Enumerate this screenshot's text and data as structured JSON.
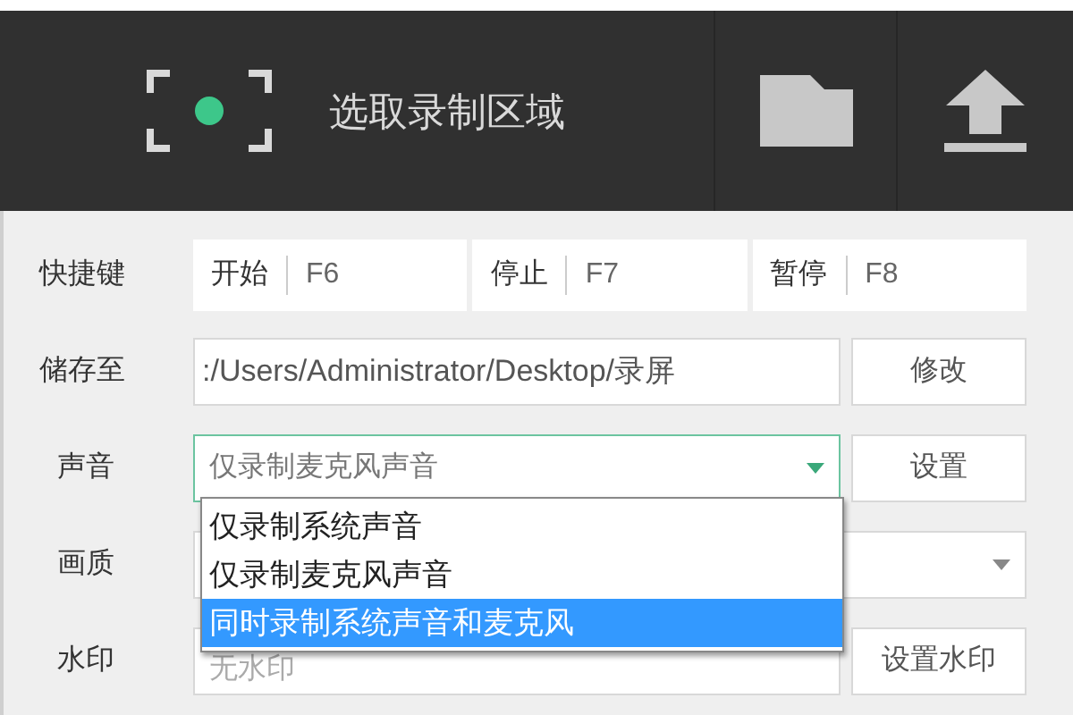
{
  "toolbar": {
    "record_area_label": "选取录制区域"
  },
  "hotkeys": {
    "label": "快捷键",
    "items": [
      {
        "action": "开始",
        "key": "F6"
      },
      {
        "action": "停止",
        "key": "F7"
      },
      {
        "action": "暂停",
        "key": "F8"
      }
    ]
  },
  "save_to": {
    "label": "储存至",
    "path": ":/Users/Administrator/Desktop/录屏",
    "button": "修改"
  },
  "sound": {
    "label": "声音",
    "value": "仅录制麦克风声音",
    "button": "设置",
    "expanded": true,
    "options": [
      {
        "label": "仅录制系统声音",
        "highlighted": false
      },
      {
        "label": "仅录制麦克风声音",
        "highlighted": false
      },
      {
        "label": "同时录制系统声音和麦克风",
        "highlighted": true
      }
    ]
  },
  "quality": {
    "label": "画质"
  },
  "watermark": {
    "label": "水印",
    "value": "无水印",
    "button": "设置水印"
  }
}
